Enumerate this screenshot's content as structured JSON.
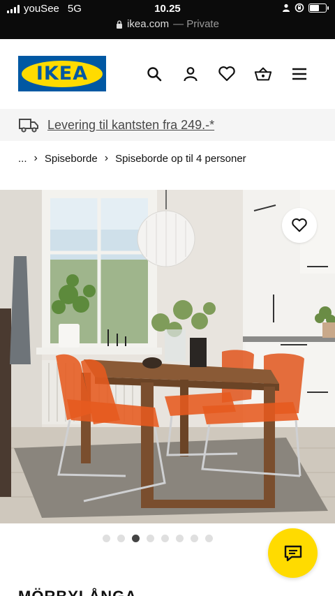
{
  "status": {
    "carrier": "youSee",
    "network": "5G",
    "time": "10.25",
    "url": "ikea.com",
    "url_suffix": "— Private"
  },
  "header": {
    "logo_text": "IKEA",
    "icons": [
      "search-icon",
      "user-icon",
      "heart-icon",
      "basket-icon",
      "menu-icon"
    ]
  },
  "banner": {
    "delivery_text": "Levering til kantsten fra 249.-*"
  },
  "breadcrumb": {
    "ellipsis": "...",
    "items": [
      "Spiseborde",
      "Spiseborde op til 4 personer"
    ]
  },
  "carousel": {
    "count": 8,
    "active_index": 2
  },
  "product": {
    "name": "MÖRBYLÅNGA"
  },
  "colors": {
    "ikea_blue": "#0058a3",
    "ikea_yellow": "#ffdb00",
    "chair_orange": "#e0551c",
    "table_wood": "#8a5a36"
  }
}
